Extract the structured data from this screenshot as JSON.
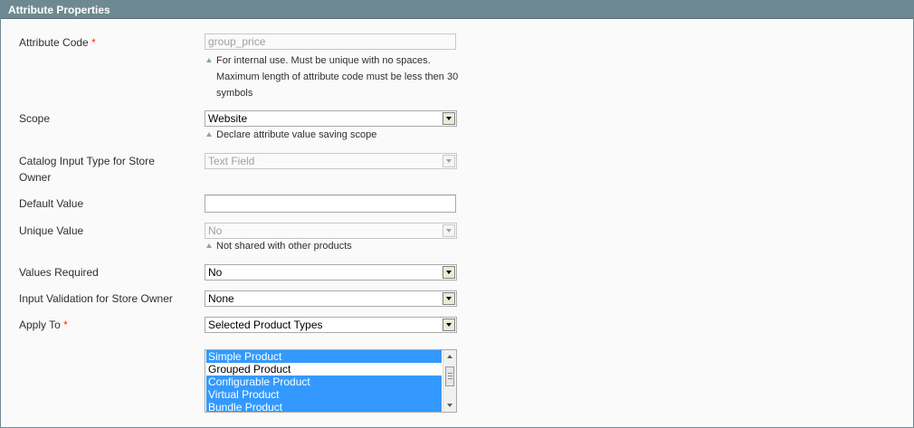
{
  "panel": {
    "title": "Attribute Properties"
  },
  "fields": {
    "attribute_code": {
      "label": "Attribute Code",
      "required_mark": "*",
      "value": "group_price",
      "note_lines": [
        "For internal use. Must be unique with no spaces.",
        "Maximum length of attribute code must be less then 30",
        "symbols"
      ]
    },
    "scope": {
      "label": "Scope",
      "value": "Website",
      "note": "Declare attribute value saving scope"
    },
    "catalog_input_type": {
      "label_lines": [
        "Catalog Input Type for Store",
        "Owner"
      ],
      "value": "Text Field"
    },
    "default_value": {
      "label": "Default Value",
      "value": ""
    },
    "unique_value": {
      "label": "Unique Value",
      "value": "No",
      "note": "Not shared with other products"
    },
    "values_required": {
      "label": "Values Required",
      "value": "No"
    },
    "input_validation": {
      "label": "Input Validation for Store Owner",
      "value": "None"
    },
    "apply_to": {
      "label": "Apply To",
      "required_mark": "*",
      "value": "Selected Product Types",
      "options": [
        {
          "label": "Simple Product",
          "selected": true
        },
        {
          "label": "Grouped Product",
          "selected": false
        },
        {
          "label": "Configurable Product",
          "selected": true
        },
        {
          "label": "Virtual Product",
          "selected": true
        },
        {
          "label": "Bundle Product",
          "selected": true
        }
      ]
    }
  },
  "colors": {
    "header_bg": "#6f8992",
    "required": "#eb340a",
    "selection": "#3399ff",
    "note_icon": "#8aa3b4"
  }
}
